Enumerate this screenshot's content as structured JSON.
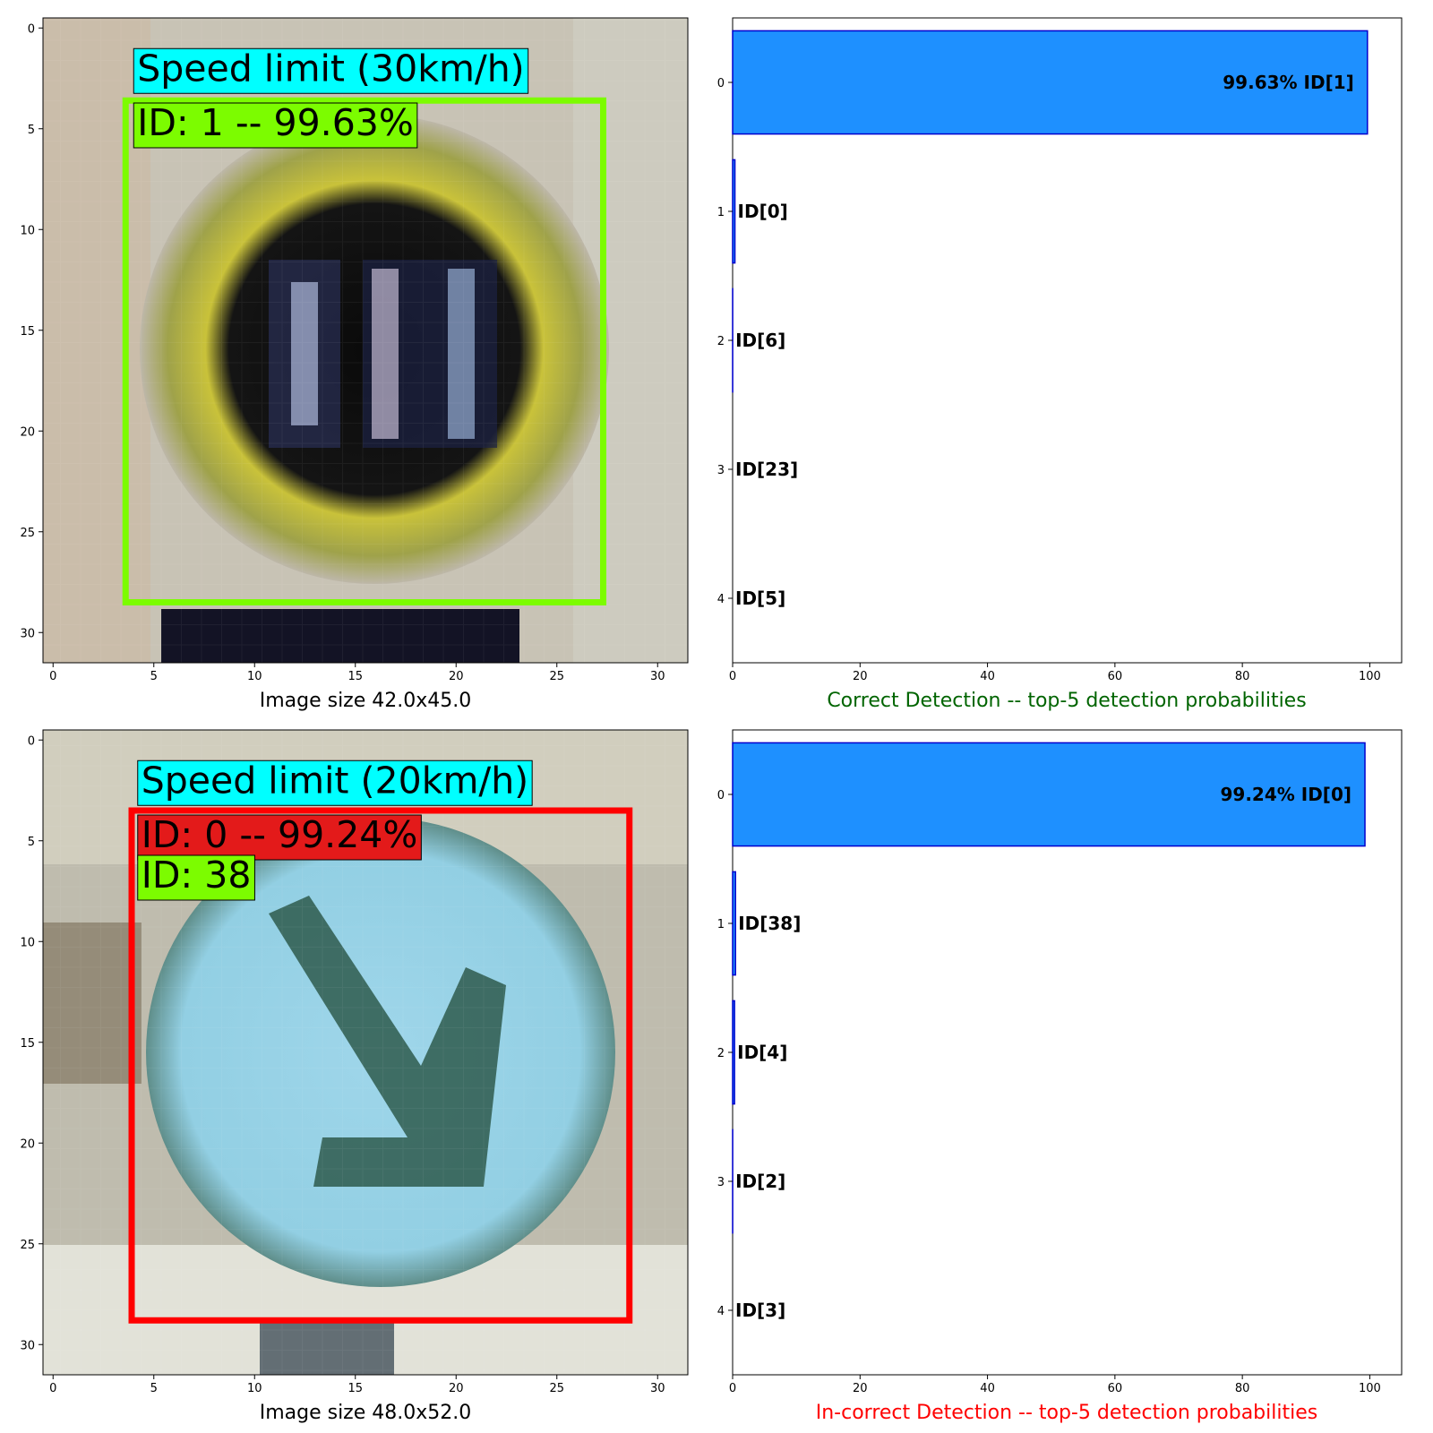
{
  "chart_data": [
    {
      "type": "image",
      "xlim": [
        -0.5,
        31.5
      ],
      "ylim": [
        31.5,
        -0.5
      ],
      "xticks": [
        0,
        5,
        10,
        15,
        20,
        25,
        30
      ],
      "yticks": [
        0,
        5,
        10,
        15,
        20,
        25,
        30
      ],
      "xlabel": "Image size 42.0x45.0",
      "image_description": "Pixelated speed limit sign with numeral 30: yellow/olive ring, dark interior",
      "boxes": [
        {
          "x0": 3.6,
          "y0": 3.6,
          "x1": 27.3,
          "y1": 28.5,
          "color": "#7cfc00"
        }
      ],
      "labels": [
        {
          "text": "Speed limit (30km/h)",
          "x": 4,
          "y": 2,
          "bg": "#00ffff"
        },
        {
          "text": "ID: 1 -- 99.63%",
          "x": 4,
          "y": 4.7,
          "bg": "#7cfc00"
        }
      ]
    },
    {
      "type": "barh",
      "title": "Correct Detection -- top-5 detection probabilities",
      "title_color": "#006400",
      "categories": [
        0,
        1,
        2,
        3,
        4
      ],
      "values": [
        99.63,
        0.36,
        0.01,
        0.0,
        0.0
      ],
      "bar_labels": [
        "99.63% ID[1]",
        "ID[0]",
        "ID[6]",
        "ID[23]",
        "ID[5]"
      ],
      "xlim": [
        0,
        105
      ],
      "xticks": [
        0,
        20,
        40,
        60,
        80,
        100
      ],
      "bar_color": "#1e90ff",
      "edge_color": "#0000cd"
    },
    {
      "type": "image",
      "xlim": [
        -0.5,
        31.5
      ],
      "ylim": [
        31.5,
        -0.5
      ],
      "xticks": [
        0,
        5,
        10,
        15,
        20,
        25,
        30
      ],
      "yticks": [
        0,
        5,
        10,
        15,
        20,
        25,
        30
      ],
      "xlabel": "Image size 48.0x52.0",
      "image_description": "Pixelated blue circular sign (keep right) with a dark arrow",
      "boxes": [
        {
          "x0": 3.9,
          "y0": 3.5,
          "x1": 28.6,
          "y1": 28.8,
          "color": "#ff0000"
        }
      ],
      "labels": [
        {
          "text": "Speed limit (20km/h)",
          "x": 4.2,
          "y": 2,
          "bg": "#00ffff"
        },
        {
          "text": "ID: 0 -- 99.24%",
          "x": 4.2,
          "y": 4.7,
          "bg": "#e31a1a"
        },
        {
          "text": "ID: 38",
          "x": 4.2,
          "y": 6.7,
          "bg": "#7cfc00"
        }
      ]
    },
    {
      "type": "barh",
      "title": "In-correct Detection -- top-5 detection probabilities",
      "title_color": "#ff0000",
      "categories": [
        0,
        1,
        2,
        3,
        4
      ],
      "values": [
        99.24,
        0.45,
        0.3,
        0.01,
        0.0
      ],
      "bar_labels": [
        "99.24% ID[0]",
        "ID[38]",
        "ID[4]",
        "ID[2]",
        "ID[3]"
      ],
      "xlim": [
        0,
        105
      ],
      "xticks": [
        0,
        20,
        40,
        60,
        80,
        100
      ],
      "bar_color": "#1e90ff",
      "edge_color": "#0000cd"
    }
  ]
}
